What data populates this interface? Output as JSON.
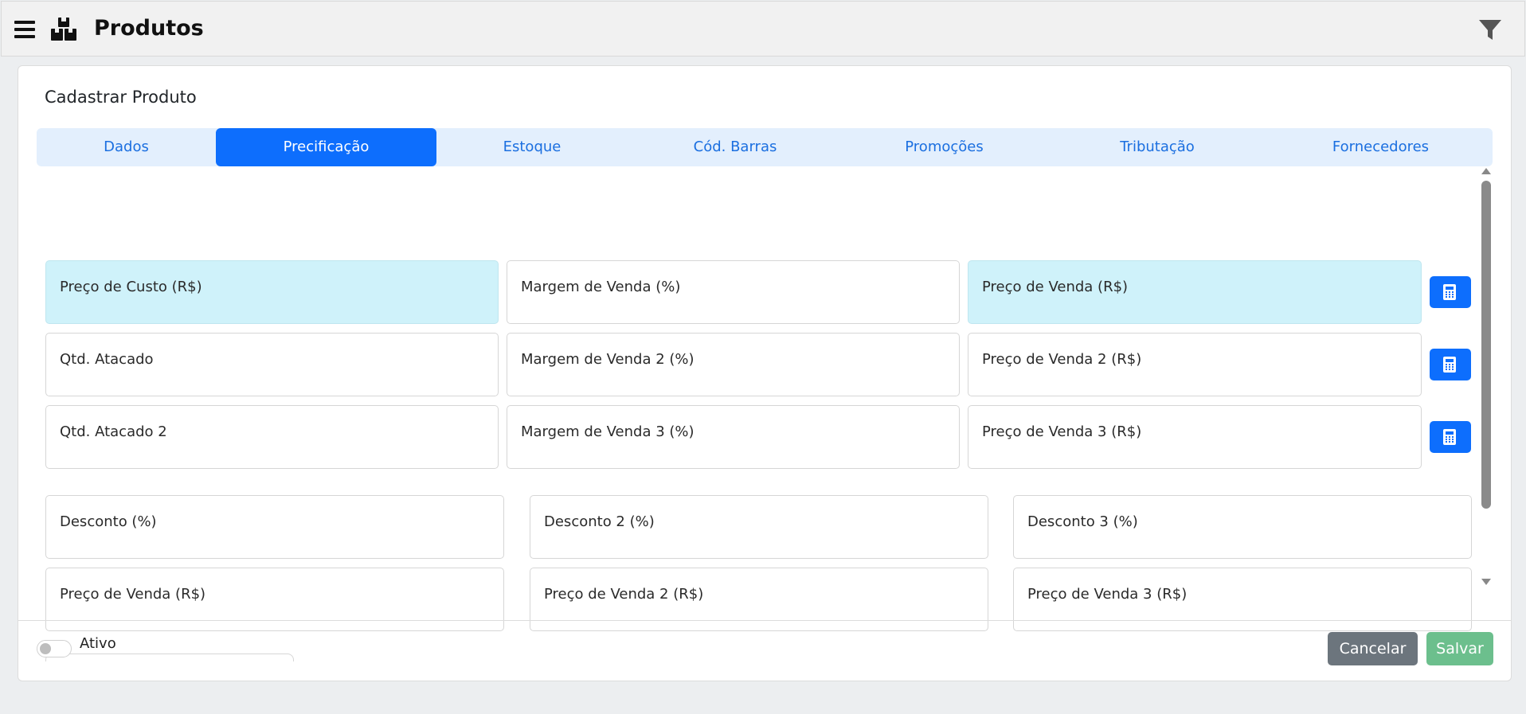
{
  "header": {
    "title": "Produtos",
    "icons": {
      "menu": "hamburger-menu-icon",
      "logo": "boxes-icon",
      "filter": "filter-icon"
    }
  },
  "card": {
    "title": "Cadastrar Produto"
  },
  "tabs": [
    {
      "label": "Dados",
      "active": false
    },
    {
      "label": "Precificação",
      "active": true
    },
    {
      "label": "Estoque",
      "active": false
    },
    {
      "label": "Cód. Barras",
      "active": false
    },
    {
      "label": "Promoções",
      "active": false
    },
    {
      "label": "Tributação",
      "active": false
    },
    {
      "label": "Fornecedores",
      "active": false
    }
  ],
  "pricing_fields": [
    [
      "Preço de Custo (R$)",
      "Margem de Venda (%)",
      "Preço de Venda (R$)"
    ],
    [
      "Qtd. Atacado",
      "Margem de Venda 2 (%)",
      "Preço de Venda 2 (R$)"
    ],
    [
      "Qtd. Atacado 2",
      "Margem de Venda 3 (%)",
      "Preço de Venda 3 (R$)"
    ]
  ],
  "discount_fields": [
    [
      "Desconto (%)",
      "Desconto 2 (%)",
      "Desconto 3 (%)"
    ],
    [
      "Preço de Venda (R$)",
      "Preço de Venda 2 (R$)",
      "Preço de Venda 3 (R$)"
    ]
  ],
  "footer": {
    "active_label": "Ativo",
    "active_on": false,
    "cancel_label": "Cancelar",
    "save_label": "Salvar"
  },
  "colors": {
    "primary": "#0d6efd",
    "highlight_field": "#cff2fa",
    "cancel": "#6c757d",
    "save": "#6cbf8d"
  }
}
